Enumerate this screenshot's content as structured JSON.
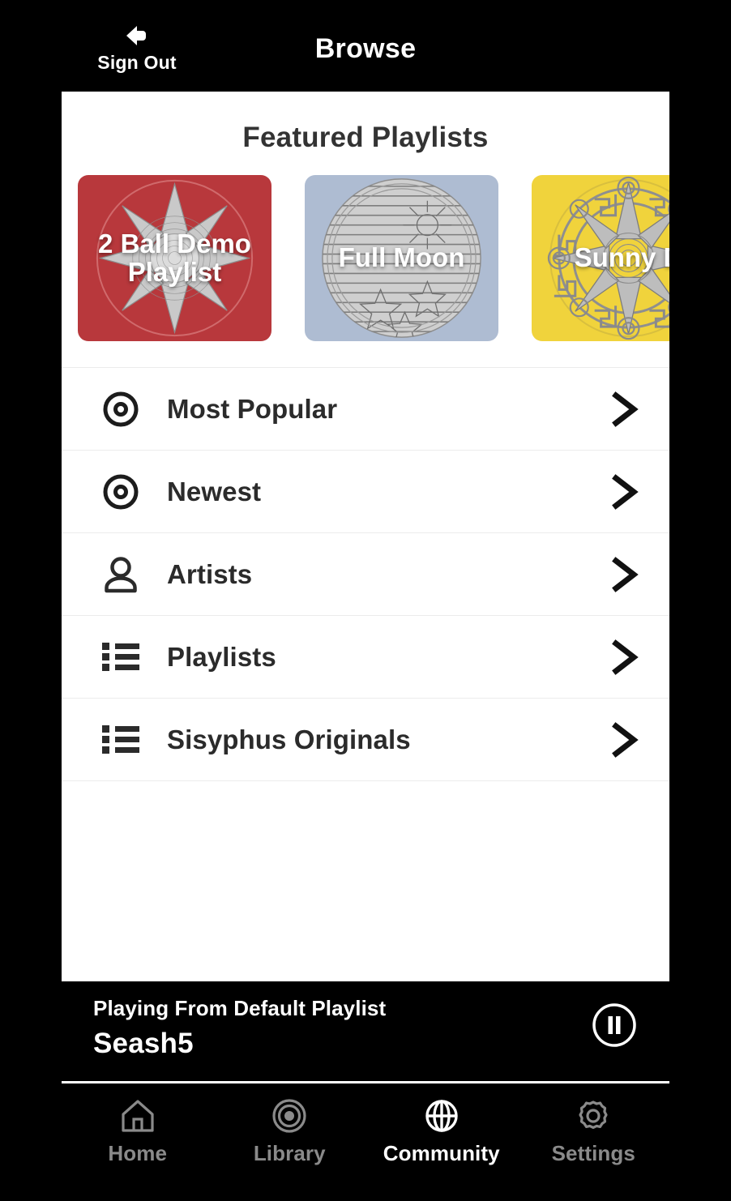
{
  "header": {
    "title": "Browse",
    "signout_label": "Sign Out",
    "signout_icon": "sign-out-arrow-icon"
  },
  "featured": {
    "heading": "Featured Playlists",
    "cards": [
      {
        "title": "2 Ball Demo Playlist",
        "bg_color": "#b8383c",
        "art": "eight-point-star-sand-pattern",
        "truncated": false
      },
      {
        "title": "Full Moon",
        "bg_color": "#aebcd2",
        "art": "striped-disc-sunburst-stars-pattern",
        "truncated": false
      },
      {
        "title": "Sunny D",
        "bg_color": "#f0d33c",
        "art": "greek-key-compass-rose-pattern",
        "truncated": true
      }
    ]
  },
  "menu": {
    "rows": [
      {
        "label": "Most Popular",
        "icon": "disc-icon",
        "chevron": "chevron-right-icon"
      },
      {
        "label": "Newest",
        "icon": "disc-icon",
        "chevron": "chevron-right-icon"
      },
      {
        "label": "Artists",
        "icon": "person-icon",
        "chevron": "chevron-right-icon"
      },
      {
        "label": "Playlists",
        "icon": "list-icon",
        "chevron": "chevron-right-icon"
      },
      {
        "label": "Sisyphus Originals",
        "icon": "list-icon",
        "chevron": "chevron-right-icon"
      }
    ]
  },
  "now_playing": {
    "source": "Playing From Default Playlist",
    "track": "Seash5",
    "button_icon": "pause-icon",
    "state": "playing"
  },
  "tabbar": {
    "active": "Community",
    "tabs": [
      {
        "label": "Home",
        "icon": "home-icon",
        "active": false
      },
      {
        "label": "Library",
        "icon": "target-icon",
        "active": false
      },
      {
        "label": "Community",
        "icon": "globe-icon",
        "active": true
      },
      {
        "label": "Settings",
        "icon": "gear-icon",
        "active": false
      }
    ]
  },
  "colors": {
    "background": "#000000",
    "panel": "#ffffff",
    "divider": "#ececec",
    "text_dark": "#2b2b2b",
    "tab_inactive": "#8a8a8a",
    "tab_active": "#ffffff"
  }
}
